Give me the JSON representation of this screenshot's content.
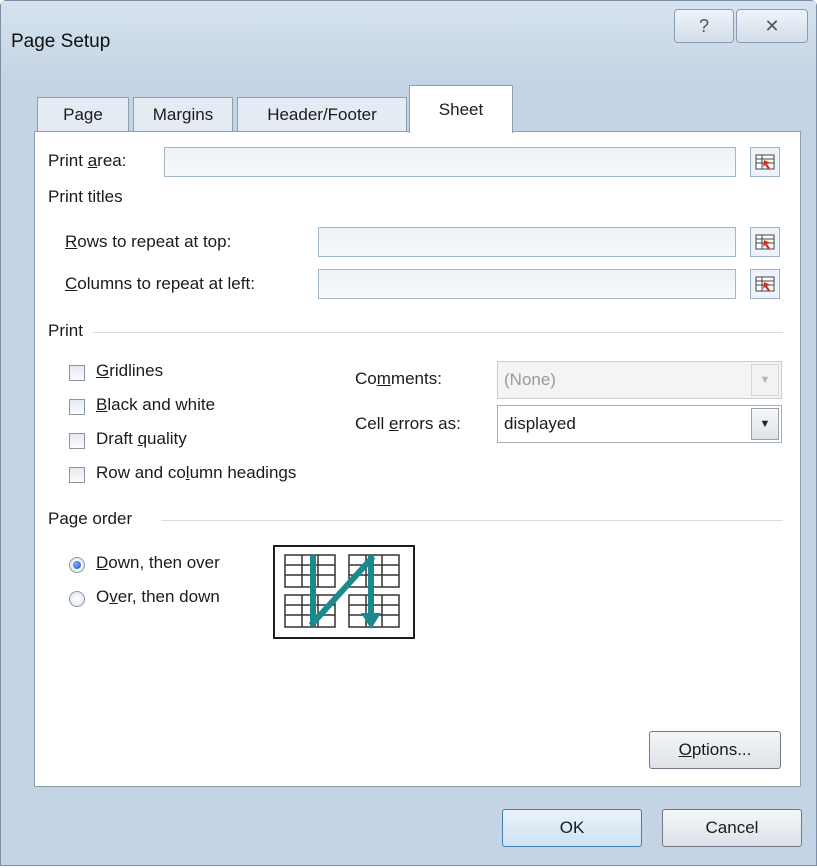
{
  "window": {
    "title": "Page Setup",
    "help_glyph": "?",
    "close_glyph": "✕"
  },
  "tabs": [
    {
      "label": "Page",
      "active": false
    },
    {
      "label": "Margins",
      "active": false
    },
    {
      "label": "Header/Footer",
      "active": false
    },
    {
      "label": "Sheet",
      "active": true
    }
  ],
  "print_area": {
    "label_pre": "Print ",
    "label_mnemonic": "a",
    "label_post": "rea:",
    "value": ""
  },
  "print_titles": {
    "heading": "Print titles",
    "rows_label_mnemonic": "R",
    "rows_label_post": "ows to repeat at top:",
    "rows_value": "",
    "cols_label_mnemonic": "C",
    "cols_label_post": "olumns to repeat at left:",
    "cols_value": ""
  },
  "print": {
    "heading": "Print",
    "gridlines": {
      "mnemonic": "G",
      "rest": "ridlines",
      "checked": false
    },
    "black_white": {
      "mnemonic": "B",
      "rest": "lack and white",
      "checked": false
    },
    "draft": {
      "pre": "Draft ",
      "mnemonic": "q",
      "rest": "uality",
      "checked": false
    },
    "headings": {
      "pre": "Row and co",
      "mnemonic": "l",
      "rest": "umn headings",
      "checked": false
    },
    "comments_label_pre": "Co",
    "comments_label_mnemonic": "m",
    "comments_label_post": "ments:",
    "comments_value": "(None)",
    "errors_label_pre": "Cell ",
    "errors_label_mnemonic": "e",
    "errors_label_post": "rrors as:",
    "errors_value": "displayed"
  },
  "page_order": {
    "heading": "Page order",
    "down_mnemonic": "D",
    "down_rest": "own, then over",
    "down_selected": true,
    "over_pre": "O",
    "over_mnemonic": "v",
    "over_rest": "er, then down",
    "over_selected": false
  },
  "buttons": {
    "options_mnemonic": "O",
    "options_rest": "ptions...",
    "ok": "OK",
    "cancel": "Cancel"
  },
  "colors": {
    "accent": "#1a8a8c",
    "frame": "#c5d4e4"
  }
}
